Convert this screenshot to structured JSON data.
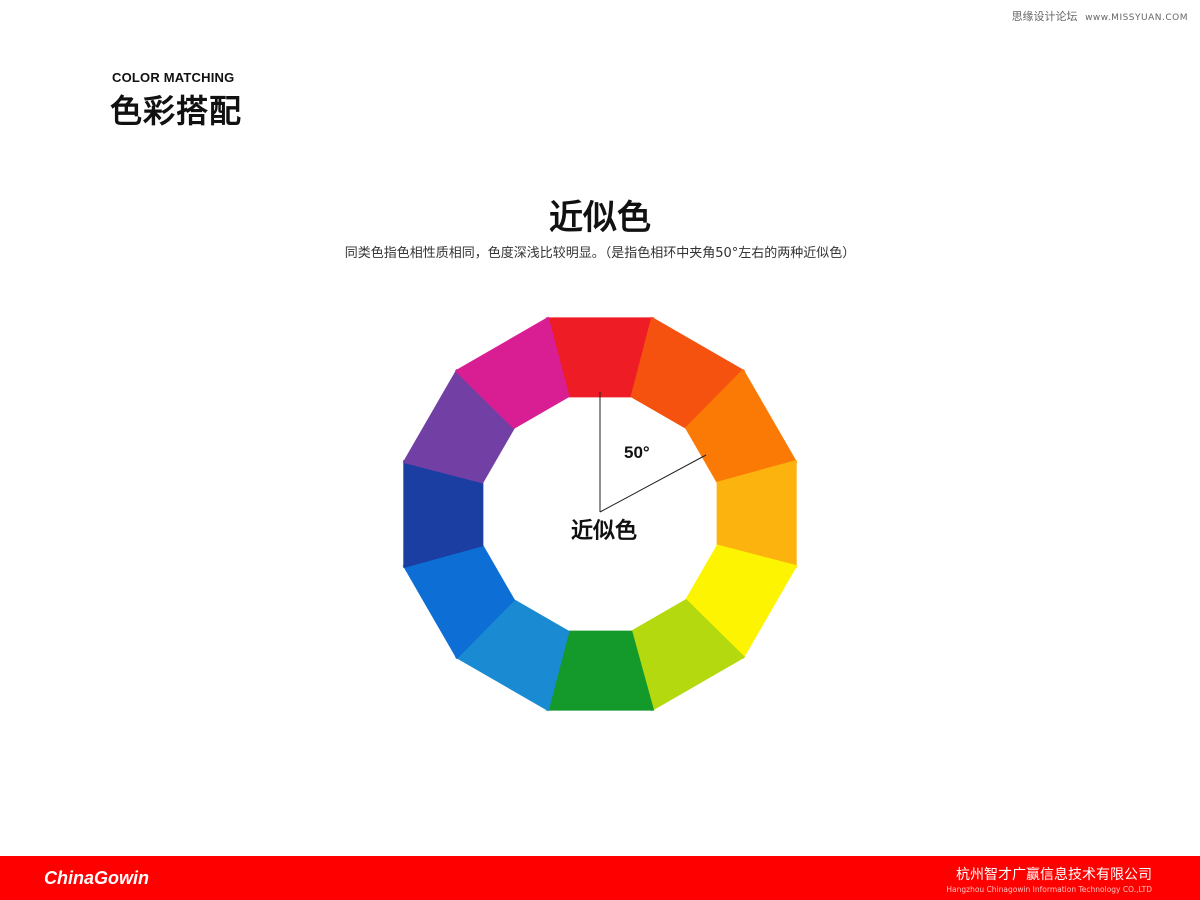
{
  "watermark": {
    "text": "思缘设计论坛",
    "site": "www.MISSYUAN.COM"
  },
  "header": {
    "title_en": "COLOR MATCHING",
    "title_cn": "色彩搭配"
  },
  "main": {
    "title": "近似色",
    "description": "同类色指色相性质相同，色度深浅比较明显。（是指色相环中夹角50°左右的两种近似色）"
  },
  "wheel": {
    "segment_colors": [
      "#ee1c25",
      "#f5520f",
      "#fb7a05",
      "#fcb30e",
      "#fdf401",
      "#b4d90e",
      "#14992b",
      "#1a8bd3",
      "#0d6fd6",
      "#1a3ea2",
      "#7240a5",
      "#d91e94"
    ],
    "angle_label": "50°",
    "center_label": "近似色"
  },
  "footer": {
    "brand": "ChinaGowin",
    "company_cn": "杭州智才广赢信息技术有限公司",
    "company_en": "Hangzhou Chinagowin Information Technology CO.,LTD",
    "background": "#ff0000"
  }
}
